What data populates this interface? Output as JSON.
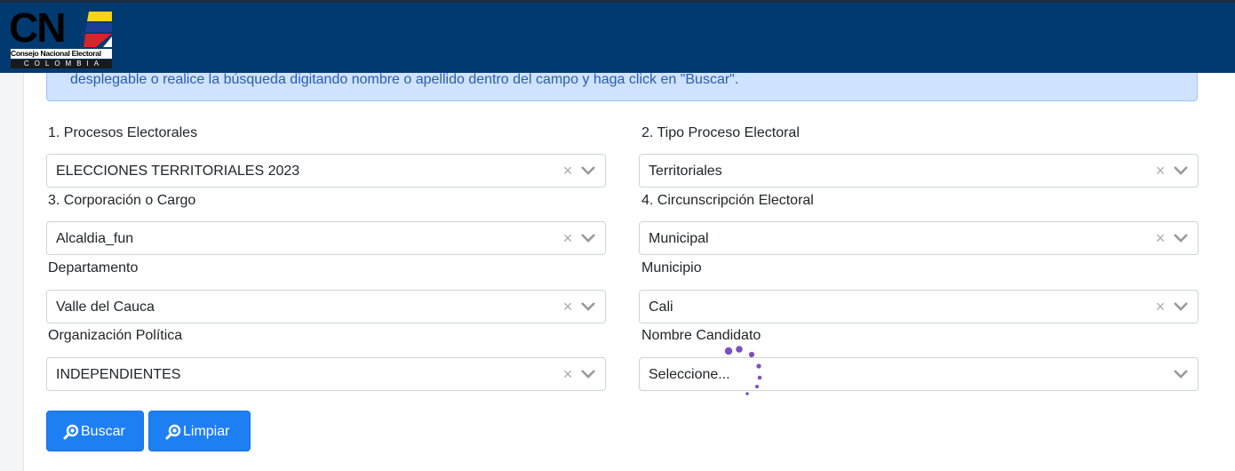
{
  "header": {
    "logo_letters": "CN",
    "logo_name": "Consejo Nacional Electoral",
    "logo_country": "COLOMBIA",
    "bar_color": "#003a70"
  },
  "alert": {
    "text": "desplegable o realice la búsqueda digitando nombre o apellido dentro del campo y haga click en \"Buscar\"."
  },
  "filters": {
    "procesos": {
      "label": "1. Procesos Electorales",
      "value": "ELECCIONES TERRITORIALES 2023"
    },
    "tipo": {
      "label": "2. Tipo Proceso Electoral",
      "value": "Territoriales"
    },
    "corporacion": {
      "label": "3. Corporación o Cargo",
      "value": "Alcaldia_fun"
    },
    "circunscripcion": {
      "label": "4. Circunscripción Electoral",
      "value": "Municipal"
    },
    "departamento": {
      "label": "Departamento",
      "value": "Valle del Cauca"
    },
    "municipio": {
      "label": "Municipio",
      "value": "Cali"
    },
    "organizacion": {
      "label": "Organización Política",
      "value": "INDEPENDIENTES"
    },
    "candidato": {
      "label": "Nombre Candidato",
      "value": "Seleccione..."
    }
  },
  "buttons": {
    "buscar": "Buscar",
    "limpiar": "Limpiar"
  },
  "icons": {
    "clear": "close-icon",
    "dropdown": "chevron-down-icon",
    "search": "search-icon",
    "loading": "loading-spinner-icon"
  },
  "colors": {
    "primary": "#1e7ff2",
    "alert_bg": "#cfe2ff",
    "alert_text": "#2a5db0",
    "spinner": "#7b4fc4"
  }
}
